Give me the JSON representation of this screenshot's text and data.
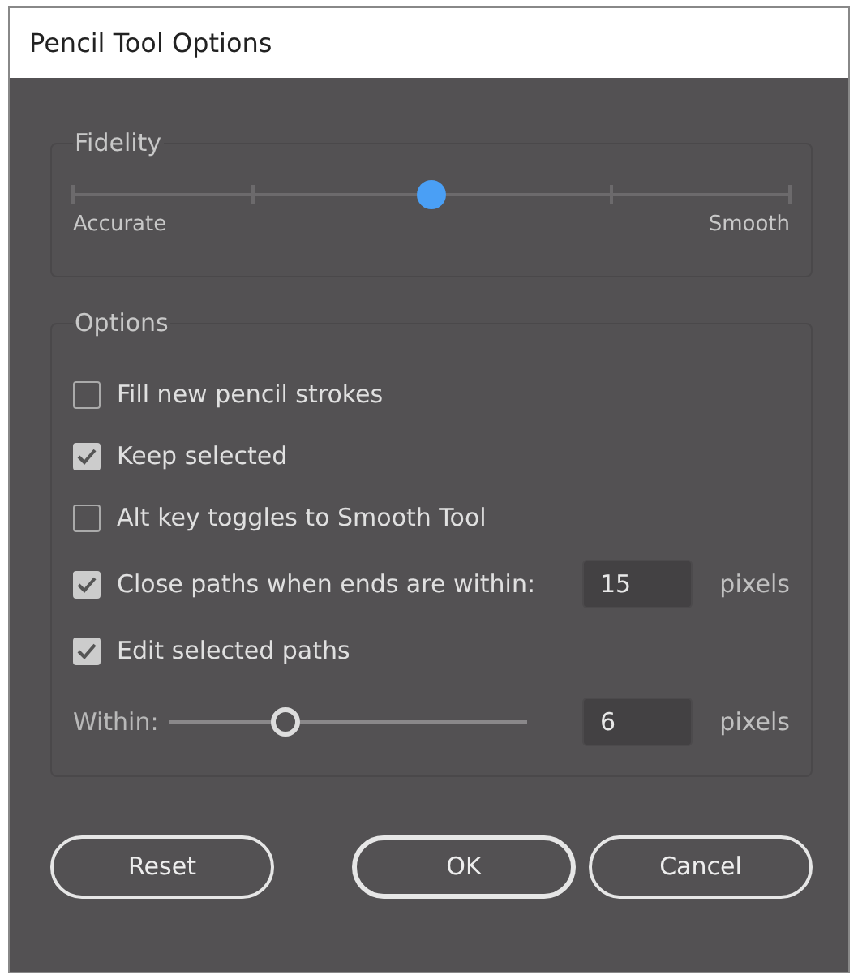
{
  "window": {
    "title": "Pencil Tool Options"
  },
  "fidelity": {
    "title": "Fidelity",
    "level": 0.5,
    "min_label": "Accurate",
    "max_label": "Smooth"
  },
  "options": {
    "title": "Options",
    "items": [
      {
        "kind": "checkbox",
        "label": "Fill new pencil strokes",
        "checked": false
      },
      {
        "kind": "checkbox",
        "label": "Keep selected",
        "checked": true
      },
      {
        "kind": "checkbox",
        "label": "Alt key toggles to Smooth Tool",
        "checked": false
      },
      {
        "kind": "checkbox_field",
        "label": "Close paths when ends are within:",
        "checked": true,
        "value": "15",
        "unit": "pixels"
      },
      {
        "kind": "checkbox",
        "label": "Edit selected paths",
        "checked": true
      },
      {
        "kind": "slider_field",
        "label": "Within:",
        "level": 0.31,
        "value": "6",
        "unit": "pixels"
      }
    ]
  },
  "buttons": [
    {
      "label": "Reset",
      "default": false
    },
    {
      "label": "OK",
      "default": true
    },
    {
      "label": "Cancel",
      "default": false
    }
  ]
}
